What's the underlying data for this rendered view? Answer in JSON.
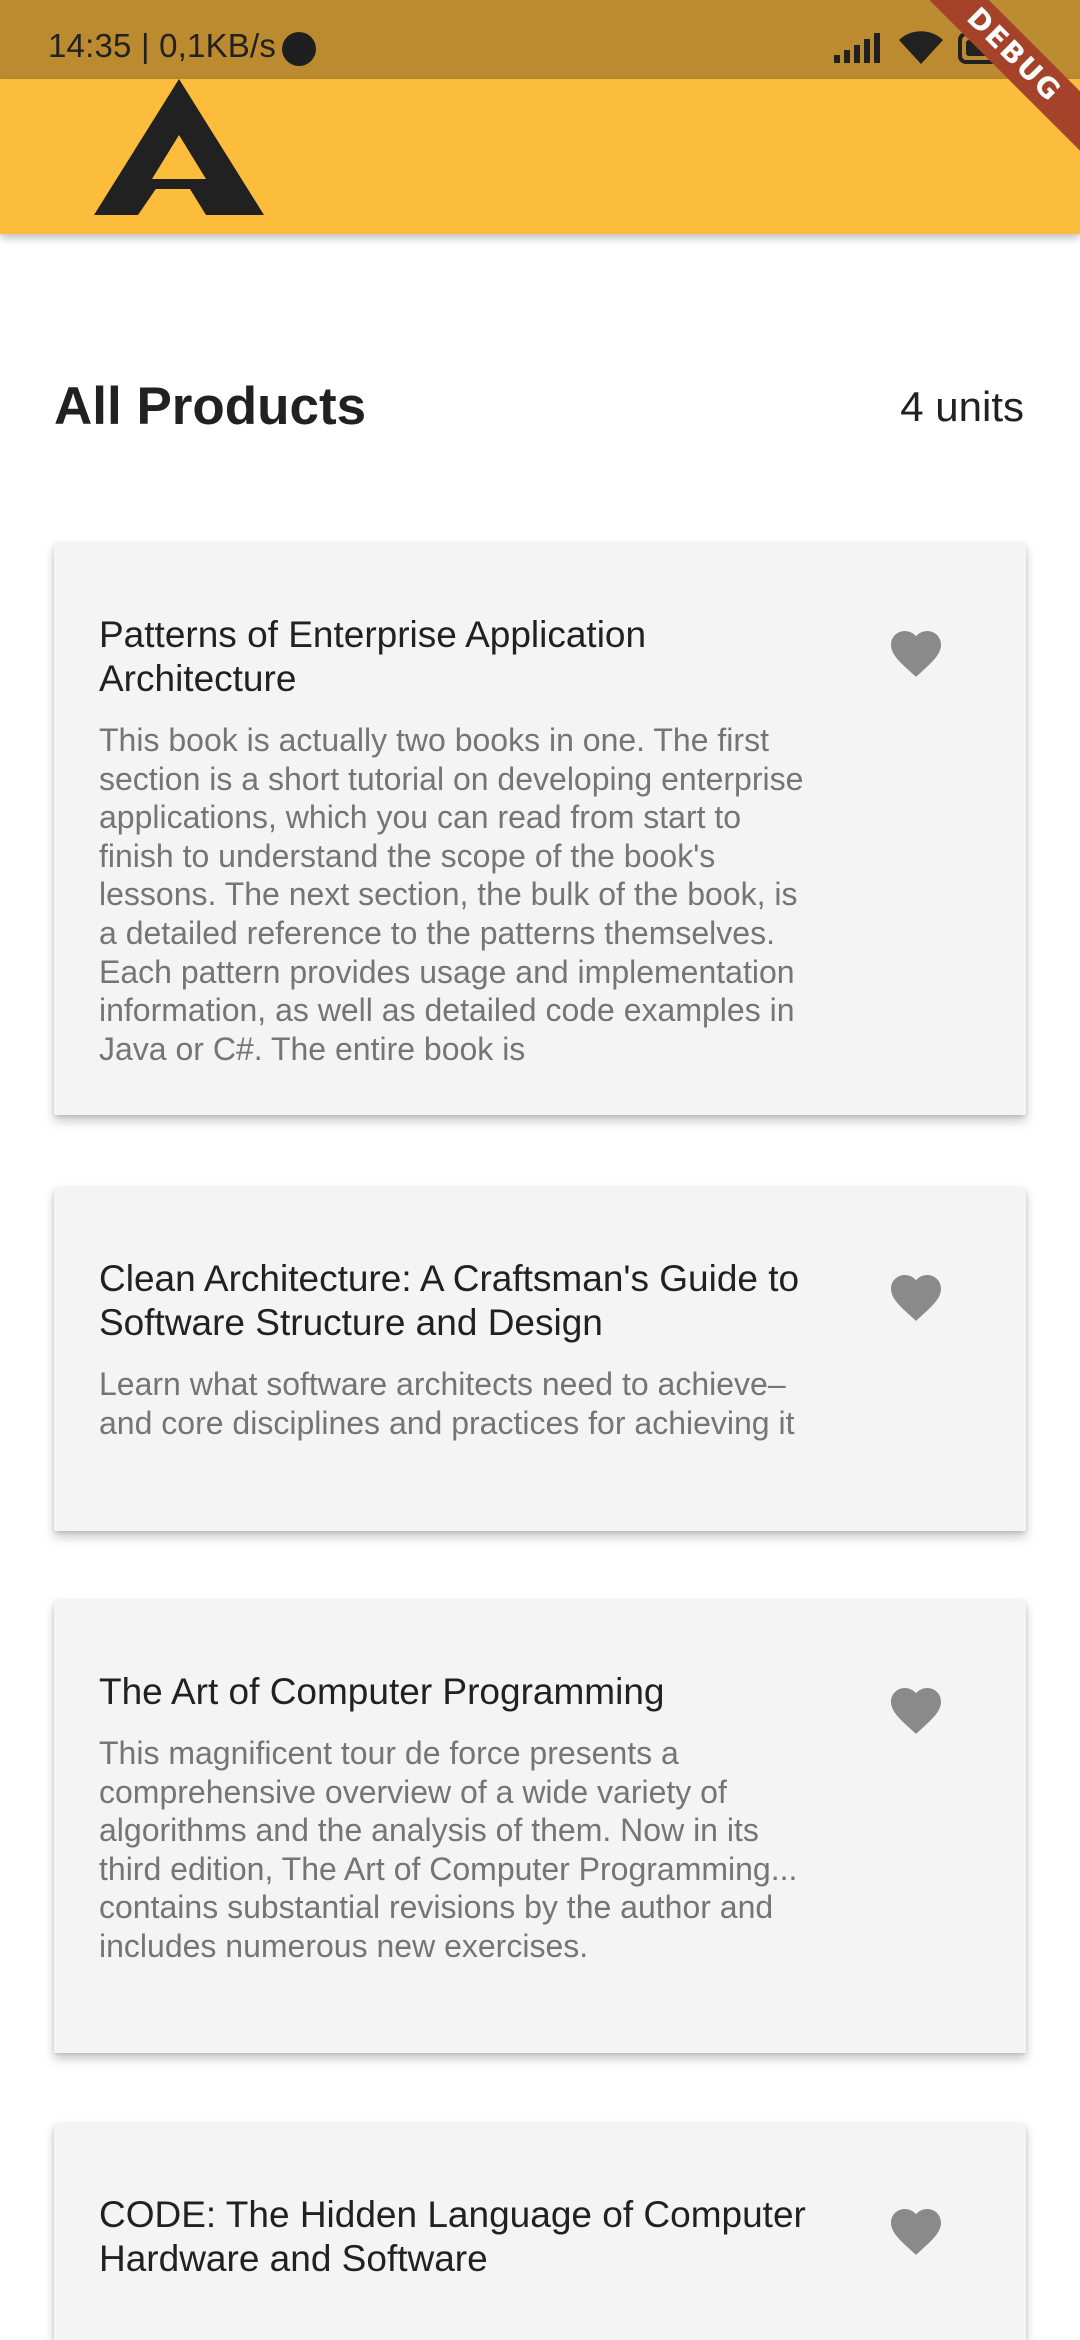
{
  "status_bar": {
    "time": "14:35 | 0,1KB/s"
  },
  "debug_banner": "DEBUG",
  "header": {
    "title": "All Products",
    "count": "4 units"
  },
  "products": [
    {
      "title": "Patterns of Enterprise Application Architecture",
      "description": "This book is actually two books in one. The first section is a short tutorial on developing enterprise applications, which you can read from start to finish to understand the scope of the book's lessons. The next section, the bulk of the book, is a detailed reference to the patterns themselves. Each pattern provides usage and implementation information, as well as detailed code examples in Java or C#. The entire book is",
      "favorite_icon": "heart-icon"
    },
    {
      "title": "Clean Architecture: A Craftsman's Guide to Software Structure and Design",
      "description": "Learn what software architects need to achieve–and core disciplines and practices for achieving it",
      "favorite_icon": "heart-icon"
    },
    {
      "title": "The Art of Computer Programming",
      "description": "This magnificent tour de force presents a comprehensive overview of a wide variety of algorithms and the analysis of them. Now in its third edition, The Art of Computer Programming... contains substantial revisions by the author and includes numerous new exercises.",
      "favorite_icon": "heart-icon"
    },
    {
      "title": "CODE: The Hidden Language of Computer Hardware and Software",
      "description": "",
      "favorite_icon": "heart-icon"
    }
  ],
  "colors": {
    "status_bar": "#BC8B2F",
    "app_bar": "#FBBD3B",
    "card_background": "#F4F4F4",
    "heart": "#8A8A8A",
    "debug_banner": "#A5432A"
  }
}
